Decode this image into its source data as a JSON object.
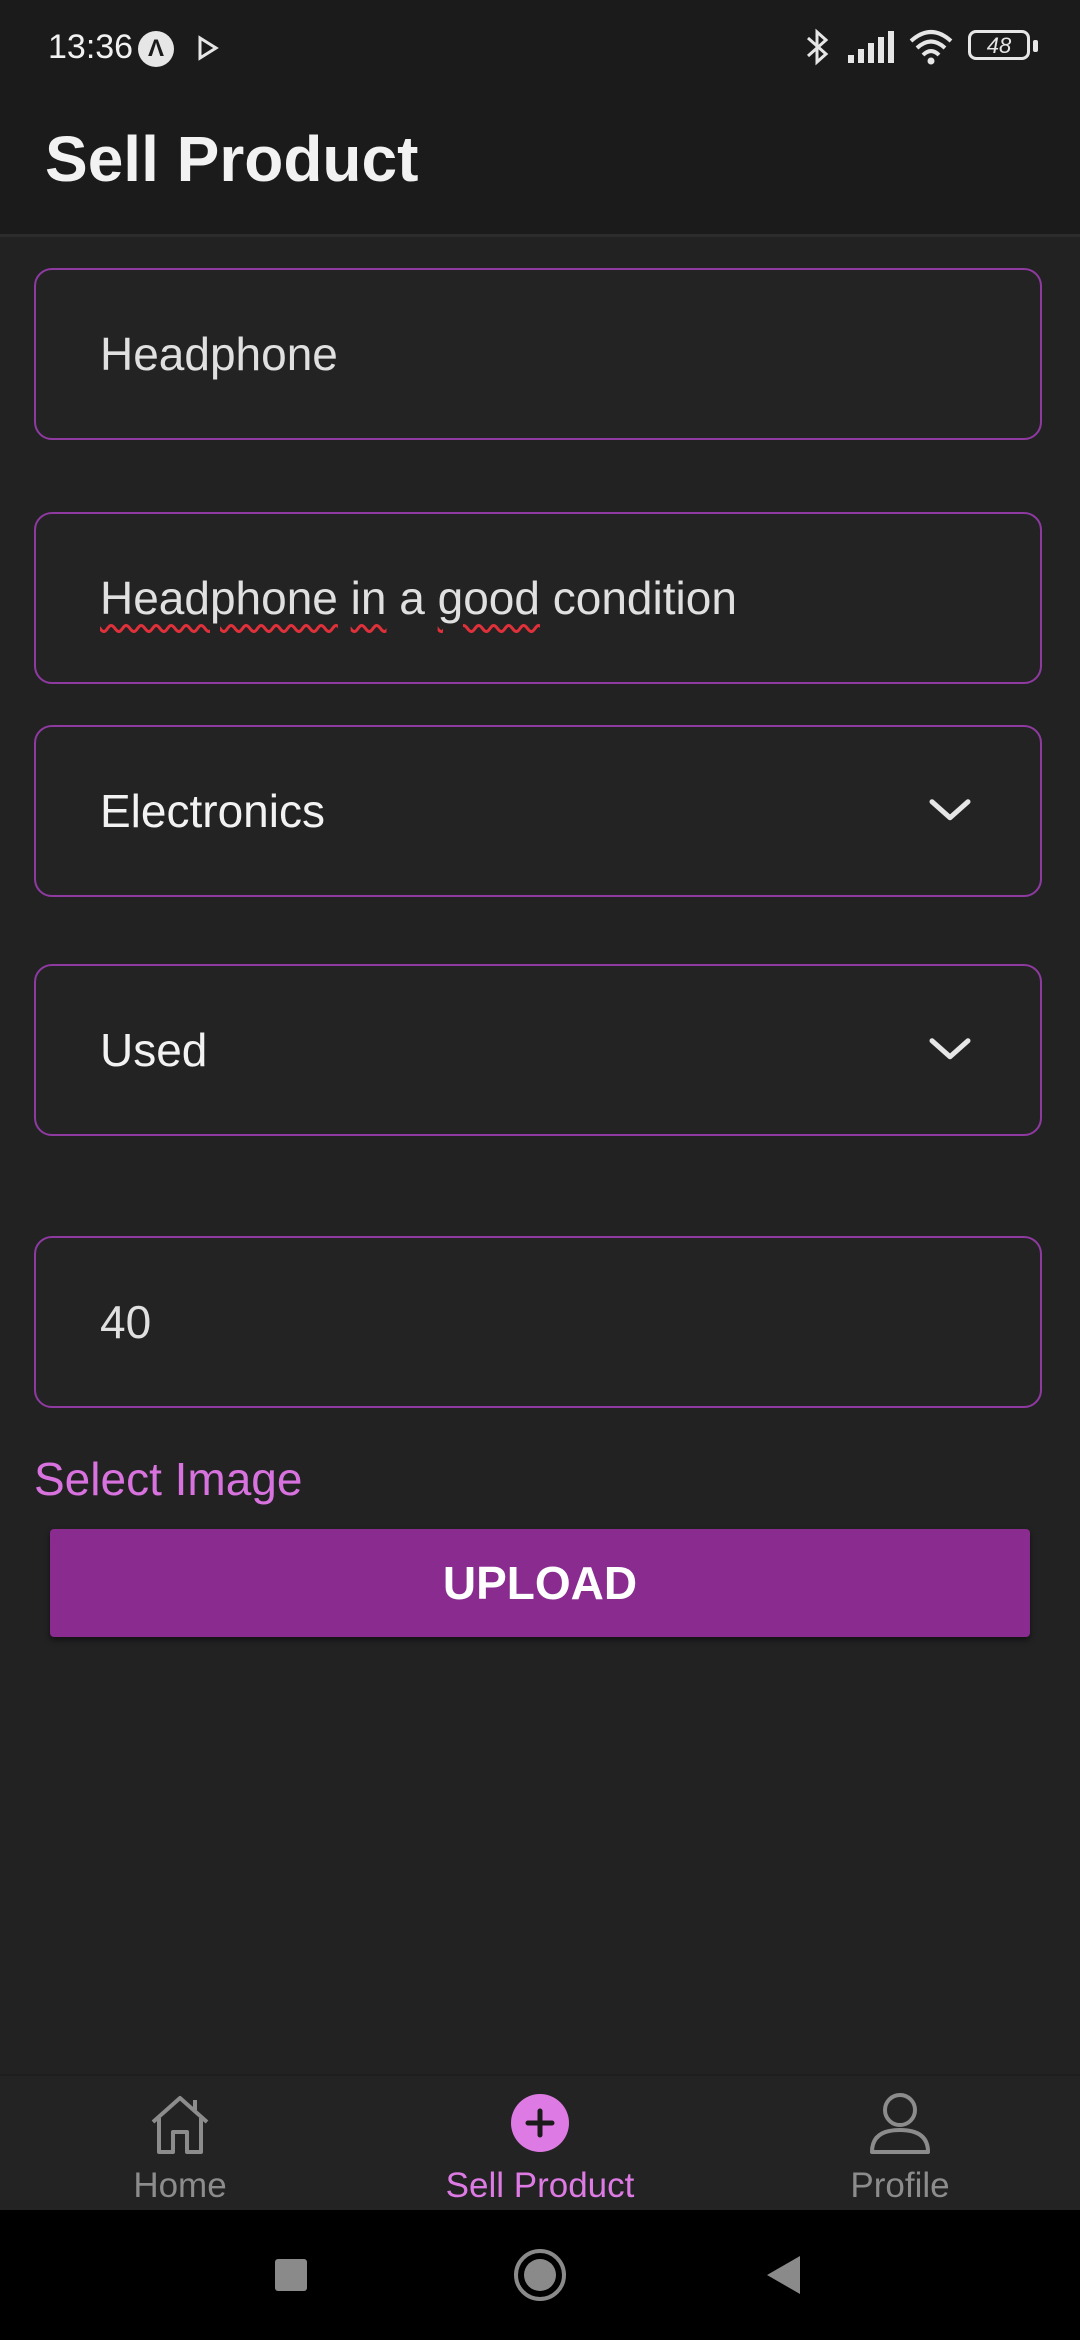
{
  "status_bar": {
    "time": "13:36",
    "battery": "48",
    "icons": [
      "a-notification-icon",
      "play-icon",
      "bluetooth-icon",
      "signal-icon",
      "wifi-icon",
      "battery-icon"
    ]
  },
  "app_bar": {
    "title": "Sell Product"
  },
  "form": {
    "name_value": "Headphone",
    "description_words": [
      "Headphone",
      "in",
      "a",
      "good",
      "condition"
    ],
    "category_value": "Electronics",
    "condition_value": "Used",
    "price_value": "40",
    "select_image_label": "Select Image",
    "upload_label": "UPLOAD"
  },
  "bottom_nav": {
    "items": [
      {
        "label": "Home",
        "icon": "home-icon",
        "active": false
      },
      {
        "label": "Sell Product",
        "icon": "add-circle-icon",
        "active": true
      },
      {
        "label": "Profile",
        "icon": "person-icon",
        "active": false
      }
    ]
  },
  "system_nav": [
    "recents-square-icon",
    "home-circle-icon",
    "back-triangle-icon"
  ],
  "colors": {
    "background": "#222223",
    "accent": "#8a2b90",
    "accent_light": "#d872de",
    "field_border": "#8e3aa0"
  }
}
